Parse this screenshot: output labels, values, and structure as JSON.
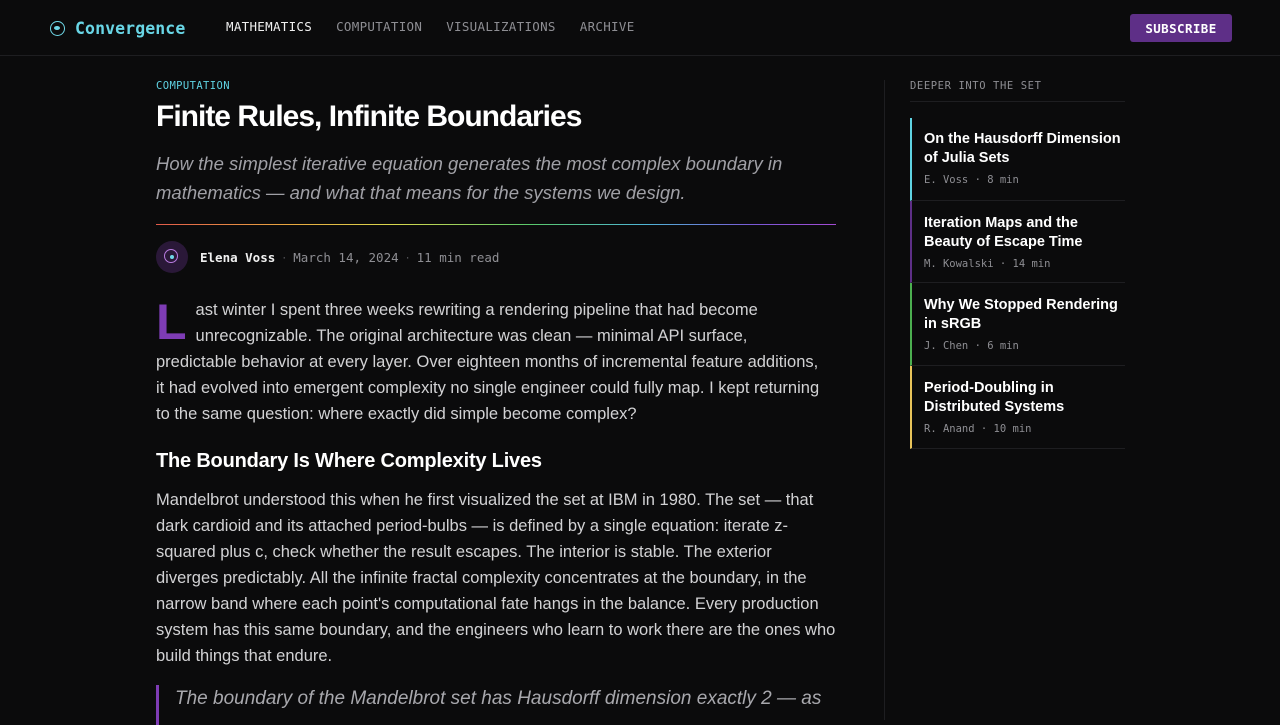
{
  "brand": {
    "name": "Convergence",
    "icon": "fractal-logo-icon",
    "accent_color": "#69d6e6"
  },
  "nav": {
    "items": [
      {
        "label": "MATHEMATICS",
        "active": true
      },
      {
        "label": "COMPUTATION",
        "active": false
      },
      {
        "label": "VISUALIZATIONS",
        "active": false
      },
      {
        "label": "ARCHIVE",
        "active": false
      }
    ],
    "subscribe_label": "SUBSCRIBE",
    "subscribe_color": "#5e2f87"
  },
  "article": {
    "category": "COMPUTATION",
    "title": "Finite Rules, Infinite Boundaries",
    "subtitle": "How the simplest iterative equation generates the most complex boundary in mathematics — and what that means for the systems we design.",
    "author": "Elena Voss",
    "date": "March 14, 2024",
    "read_time": "11 min read",
    "separator": "·",
    "drop_cap": "L",
    "drop_cap_color": "#7e3cb5",
    "paragraph1": "ast winter I spent three weeks rewriting a rendering pipeline that had become unrecognizable. The original architecture was clean — minimal API surface, predictable behavior at every layer. Over eighteen months of incremental feature additions, it had evolved into emergent complexity no single engineer could fully map. I kept returning to the same question: where exactly did simple become complex?",
    "heading2": "The Boundary Is Where Complexity Lives",
    "paragraph2": "Mandelbrot understood this when he first visualized the set at IBM in 1980. The set — that dark cardioid and its attached period-bulbs — is defined by a single equation: iterate z-squared plus c, check whether the result escapes. The interior is stable. The exterior diverges predictably. All the infinite fractal complexity concentrates at the boundary, in the narrow band where each point's computational fate hangs in the balance. Every production system has this same boundary, and the engineers who learn to work there are the ones who build things that endure.",
    "quote": "The boundary of the Mandelbrot set has Hausdorff dimension exactly 2 — as"
  },
  "sidebar": {
    "heading": "DEEPER INTO THE SET",
    "items": [
      {
        "title": "On the Hausdorff Dimension of Julia Sets",
        "meta": "E. Voss · 8 min",
        "color": "#5fd3e3"
      },
      {
        "title": "Iteration Maps and the Beauty of Escape Time",
        "meta": "M. Kowalski · 14 min",
        "color": "#5e2f87"
      },
      {
        "title": "Why We Stopped Rendering in sRGB",
        "meta": "J. Chen · 6 min",
        "color": "#4caf50"
      },
      {
        "title": "Period-Doubling in Distributed Systems",
        "meta": "R. Anand · 10 min",
        "color": "#e8c45a"
      }
    ]
  }
}
